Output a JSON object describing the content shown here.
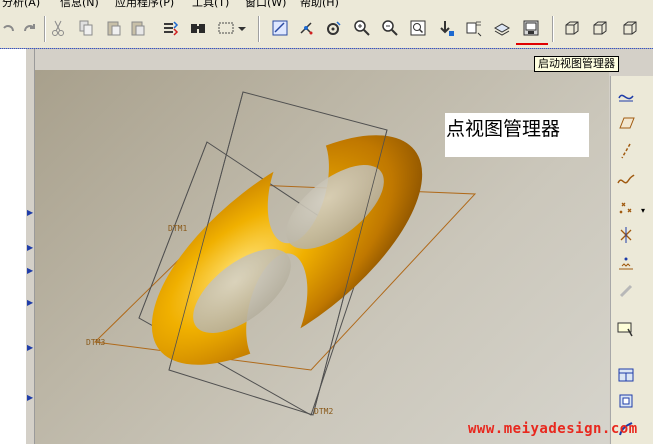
{
  "menubar": {
    "items": [
      "分析(A)",
      "信息(N)",
      "应用程序(P)",
      "工具(T)",
      "窗口(W)",
      "帮助(H)"
    ]
  },
  "tooltip": {
    "text": "启动视图管理器"
  },
  "callout": {
    "text": "点视图管理器"
  },
  "datums": {
    "dtm1": "DTM1",
    "dtm2": "DTM2",
    "dtm3": "DTM3"
  },
  "watermark": {
    "text": "www.meiyadesign.com"
  },
  "colors": {
    "accent_red": "#e00000",
    "model_gold": "#e8a000",
    "datum_line": "#b06a1a",
    "viewport_bg": "#bcb6a6"
  }
}
